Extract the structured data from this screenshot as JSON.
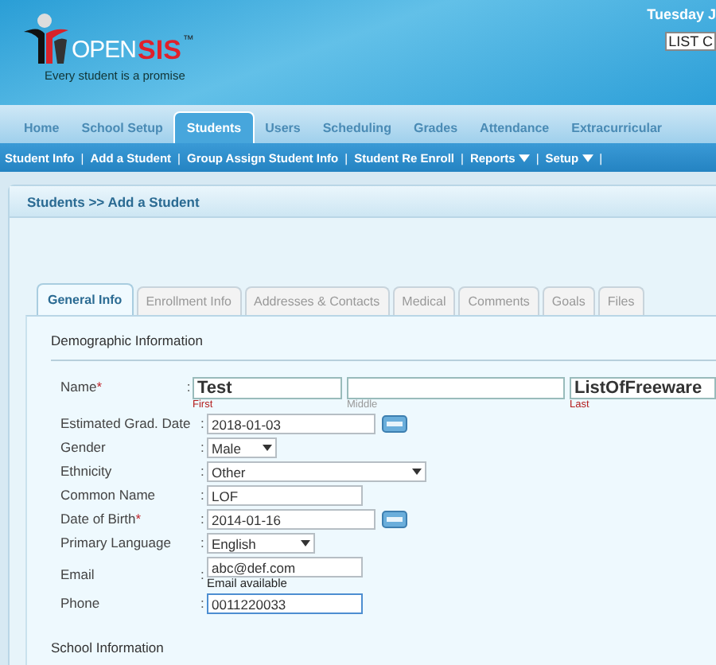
{
  "header": {
    "logo": {
      "open": "OPEN",
      "sis": "SIS",
      "tm": "™",
      "tagline": "Every student is a promise"
    },
    "date": "Tuesday J",
    "school_select": "LIST C"
  },
  "nav": [
    {
      "label": "Home",
      "selected": false
    },
    {
      "label": "School Setup",
      "selected": false
    },
    {
      "label": "Students",
      "selected": true
    },
    {
      "label": "Users",
      "selected": false
    },
    {
      "label": "Scheduling",
      "selected": false
    },
    {
      "label": "Grades",
      "selected": false
    },
    {
      "label": "Attendance",
      "selected": false
    },
    {
      "label": "Extracurricular",
      "selected": false
    }
  ],
  "subnav": [
    {
      "label": "Student Info",
      "kind": "link",
      "sep": "|"
    },
    {
      "label": "Add a Student",
      "kind": "link",
      "sep": "|"
    },
    {
      "label": "Group Assign Student Info",
      "kind": "link",
      "sep": "|"
    },
    {
      "label": "Student Re Enroll",
      "kind": "link",
      "sep": "|"
    },
    {
      "label": "Reports",
      "kind": "menu",
      "sep": "|"
    },
    {
      "label": "Setup",
      "kind": "menu",
      "sep": "|"
    }
  ],
  "breadcrumb": "Students >> Add a Student",
  "tabs": [
    {
      "label": "General Info",
      "selected": true
    },
    {
      "label": "Enrollment Info",
      "selected": false
    },
    {
      "label": "Addresses & Contacts",
      "selected": false
    },
    {
      "label": "Medical",
      "selected": false
    },
    {
      "label": "Comments",
      "selected": false
    },
    {
      "label": "Goals",
      "selected": false
    },
    {
      "label": "Files",
      "selected": false
    }
  ],
  "section_title": "Demographic Information",
  "fields": [
    {
      "kind": "name",
      "label": "Name",
      "mark": "*",
      "colon": ":",
      "parts": [
        {
          "value": "Test",
          "caption": "First",
          "required": true
        },
        {
          "caption": "Middle",
          "required": false
        },
        {
          "value": "ListOfFreeware",
          "caption": "Last",
          "required": true
        }
      ]
    },
    {
      "kind": "date",
      "label": "Estimated Grad. Date",
      "colon": ":",
      "value": "2018-01-03"
    },
    {
      "kind": "select",
      "label": "Gender",
      "colon": ":",
      "value": "Male"
    },
    {
      "kind": "select",
      "label": "Ethnicity",
      "colon": ":",
      "value": "Other"
    },
    {
      "kind": "text",
      "label": "Common Name",
      "colon": ":",
      "value": "LOF"
    },
    {
      "kind": "date",
      "label": "Date of Birth",
      "mark": "*",
      "colon": ":",
      "value": "2014-01-16"
    },
    {
      "kind": "select",
      "label": "Primary Language",
      "colon": ":",
      "value": "English"
    },
    {
      "kind": "text",
      "label": "Email",
      "colon": ":",
      "value": "abc@def.com",
      "note": "Email available"
    },
    {
      "kind": "text",
      "label": "Phone",
      "colon": ":",
      "value": "0011220033",
      "focused": true
    }
  ],
  "next_section_title": "School Information"
}
